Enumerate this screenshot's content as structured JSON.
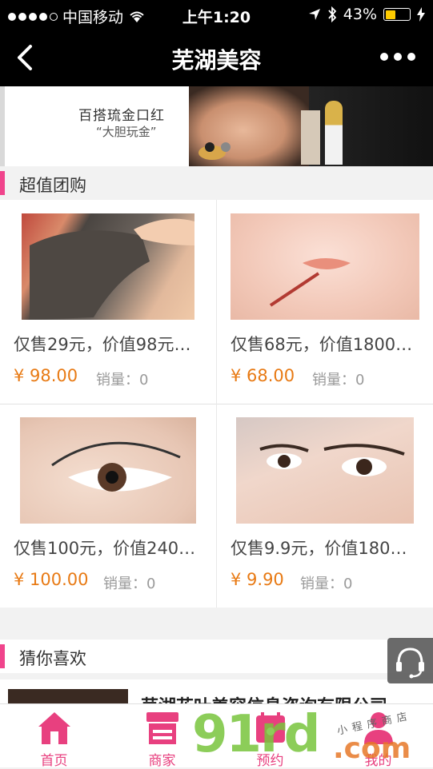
{
  "status_bar": {
    "carrier": "中国移动",
    "time": "上午1:20",
    "battery": "43%",
    "battery_level": 0.43,
    "signal_icon": "signal-dots-icon",
    "wifi_icon": "wifi-icon",
    "location_icon": "location-arrow-icon",
    "bluetooth_icon": "bluetooth-icon",
    "charging_icon": "charging-bolt-icon"
  },
  "nav": {
    "title": "芜湖美容",
    "back_icon": "chevron-left-icon",
    "more_icon": "more-dots-icon"
  },
  "banner": {
    "tagline": "百搭琉金口红",
    "sub": "“大胆玩金”"
  },
  "group_buy": {
    "title": "超值团购",
    "items": [
      {
        "name": "仅售29元，价值98元…",
        "price": "¥ 98.00",
        "sales": "销量：0"
      },
      {
        "name": "仅售68元，价值1800…",
        "price": "¥ 68.00",
        "sales": "销量：0"
      },
      {
        "name": "仅售100元，价值240…",
        "price": "¥ 100.00",
        "sales": "销量：0"
      },
      {
        "name": "仅售9.9元，价值180…",
        "price": "¥ 9.90",
        "sales": "销量：0"
      }
    ]
  },
  "recommend": {
    "title": "猜你喜欢",
    "company": "芜湖花叶美容信息咨询有限公司"
  },
  "support": {
    "icon": "headset-icon"
  },
  "tabbar": {
    "tabs": [
      {
        "label": "首页",
        "icon": "home-icon"
      },
      {
        "label": "商家",
        "icon": "store-icon"
      },
      {
        "label": "预约",
        "icon": "calendar-icon"
      },
      {
        "label": "我的",
        "icon": "user-icon"
      }
    ]
  },
  "watermark": {
    "brand": "91rd",
    "domain": ".com",
    "shop": "小程序商店"
  },
  "colors": {
    "accent": "#f0448c",
    "price": "#e87a14",
    "tab": "#e8407f"
  }
}
